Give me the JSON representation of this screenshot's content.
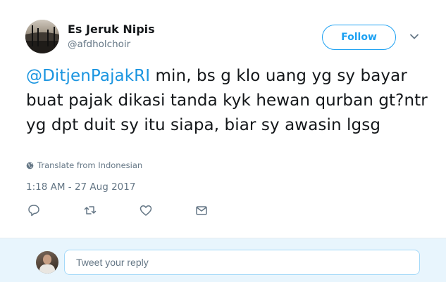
{
  "tweet": {
    "display_name": "Es Jeruk Nipis",
    "screen_name": "@afdholchoir",
    "follow_label": "Follow",
    "text_mention": "@DitjenPajakRI",
    "text_body": " min, bs g klo uang yg sy bayar buat pajak dikasi tanda kyk hewan qurban gt?ntr yg dpt duit sy itu siapa, biar sy awasin lgsg",
    "translate_label": "Translate from Indonesian",
    "timestamp": "1:18 AM - 27 Aug 2017"
  },
  "actions": [
    {
      "icon": "reply-icon"
    },
    {
      "icon": "retweet-icon"
    },
    {
      "icon": "like-icon"
    },
    {
      "icon": "direct-message-icon"
    }
  ],
  "reply": {
    "placeholder": "Tweet your reply"
  },
  "colors": {
    "accent": "#1da1f2",
    "mention": "#1b95e0",
    "secondary_text": "#657786",
    "reply_background": "#e8f5fd"
  }
}
